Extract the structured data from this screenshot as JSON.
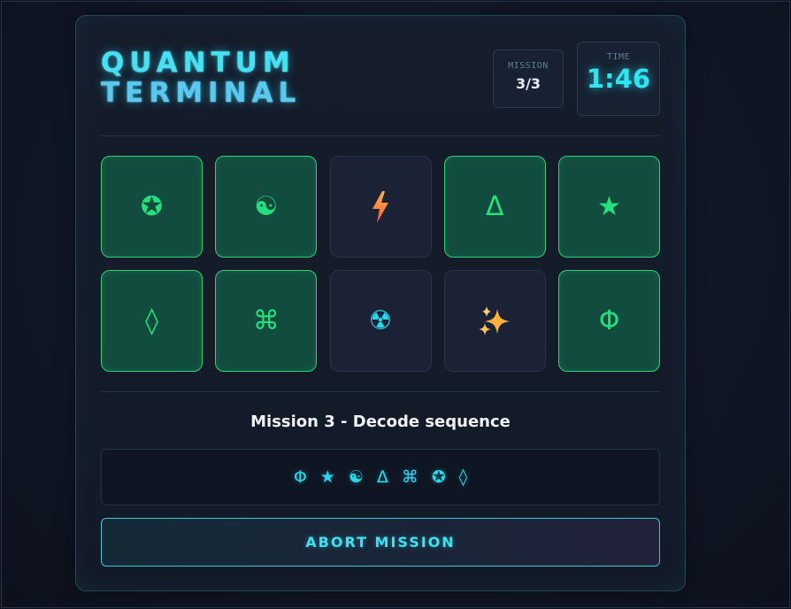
{
  "header": {
    "title_line1": "QUANTUM",
    "title_line2": "TERMINAL"
  },
  "stats": {
    "mission_label": "MISSION",
    "mission_value": "3/3",
    "time_label": "TIME",
    "time_value": "1:46"
  },
  "grid": {
    "tiles": [
      {
        "symbol": "✪",
        "state": "matched",
        "icon": "circled-star-icon"
      },
      {
        "symbol": "☯",
        "state": "matched",
        "icon": "yin-yang-icon"
      },
      {
        "symbol": "⚡",
        "state": "revealed",
        "icon": "lightning-icon"
      },
      {
        "symbol": "Δ",
        "state": "matched",
        "icon": "delta-icon"
      },
      {
        "symbol": "★",
        "state": "matched",
        "icon": "star-icon"
      },
      {
        "symbol": "◊",
        "state": "matched",
        "icon": "diamond-icon"
      },
      {
        "symbol": "⌘",
        "state": "matched",
        "icon": "command-icon"
      },
      {
        "symbol": "☢",
        "state": "revealed",
        "icon": "radioactive-icon"
      },
      {
        "symbol": "✨",
        "state": "revealed",
        "icon": "sparkles-icon"
      },
      {
        "symbol": "Φ",
        "state": "matched",
        "icon": "phi-icon"
      }
    ]
  },
  "mission": {
    "title": "Mission 3 - Decode sequence",
    "sequence": [
      "Φ",
      "★",
      "☯",
      "Δ",
      "⌘",
      "✪",
      "◊"
    ]
  },
  "actions": {
    "abort_label": "ABORT MISSION"
  },
  "colors": {
    "accent_cyan": "#2ee6f2",
    "matched_green": "#22e07c",
    "matched_bg": "#124c3e",
    "hidden_bg": "#1b2236"
  }
}
